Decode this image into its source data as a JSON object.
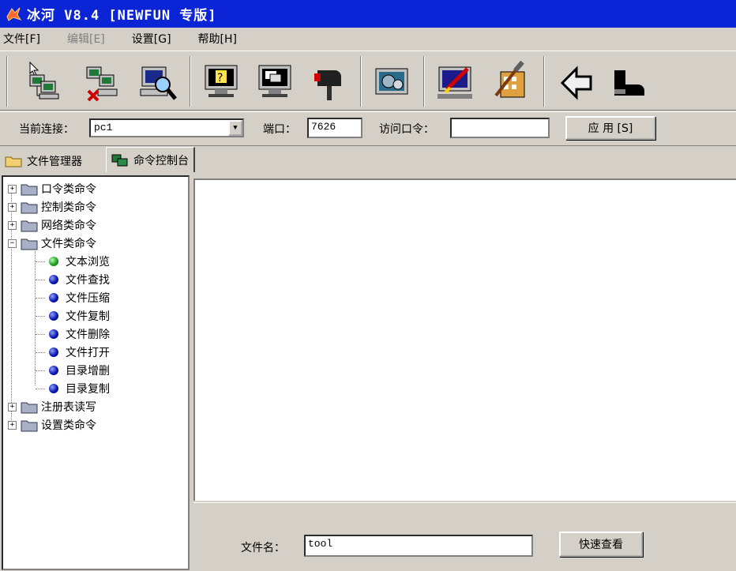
{
  "window": {
    "title": "冰河 V8.4 [NEWFUN 专版]"
  },
  "menu": [
    {
      "label": "文件[F]",
      "enabled": true
    },
    {
      "label": "编辑[E]",
      "enabled": false
    },
    {
      "label": "设置[G]",
      "enabled": true
    },
    {
      "label": "帮助[H]",
      "enabled": true
    }
  ],
  "toolbar": {
    "buttons": [
      {
        "icon": "add-computer-icon"
      },
      {
        "icon": "remove-computer-icon"
      },
      {
        "icon": "search-computer-icon"
      },
      {
        "icon": "help-monitor-icon"
      },
      {
        "icon": "screen-capture-icon"
      },
      {
        "icon": "mailbox-icon"
      },
      {
        "icon": "system-settings-icon"
      },
      {
        "icon": "config-server-icon"
      },
      {
        "icon": "tools-icon"
      },
      {
        "icon": "back-arrow-icon"
      },
      {
        "icon": "exit-boot-icon"
      }
    ]
  },
  "connection": {
    "current_label": "当前连接：",
    "current_value": "pc1",
    "port_label": "端口：",
    "port_value": "7626",
    "password_label": "访问口令：",
    "password_value": "",
    "apply_label": "应 用 [S]"
  },
  "tabs": [
    {
      "label": "文件管理器",
      "active": false
    },
    {
      "label": "命令控制台",
      "active": true
    }
  ],
  "tree": {
    "categories": [
      {
        "label": "口令类命令",
        "expanded": false
      },
      {
        "label": "控制类命令",
        "expanded": false
      },
      {
        "label": "网络类命令",
        "expanded": false
      },
      {
        "label": "文件类命令",
        "expanded": true
      },
      {
        "label": "注册表读写",
        "expanded": false
      },
      {
        "label": "设置类命令",
        "expanded": false
      }
    ],
    "file_commands": [
      {
        "label": "文本浏览",
        "selected": true
      },
      {
        "label": "文件查找",
        "selected": false
      },
      {
        "label": "文件压缩",
        "selected": false
      },
      {
        "label": "文件复制",
        "selected": false
      },
      {
        "label": "文件删除",
        "selected": false
      },
      {
        "label": "文件打开",
        "selected": false
      },
      {
        "label": "目录增删",
        "selected": false
      },
      {
        "label": "目录复制",
        "selected": false
      }
    ]
  },
  "viewer": {
    "filename_label": "文件名：",
    "filename_value": "tool",
    "quick_view_label": "快速查看"
  },
  "colors": {
    "titlebar": "#0a24d6",
    "face": "#d4d0c8",
    "green_dot": "#1ea01e",
    "blue_dot": "#0a18b0"
  }
}
